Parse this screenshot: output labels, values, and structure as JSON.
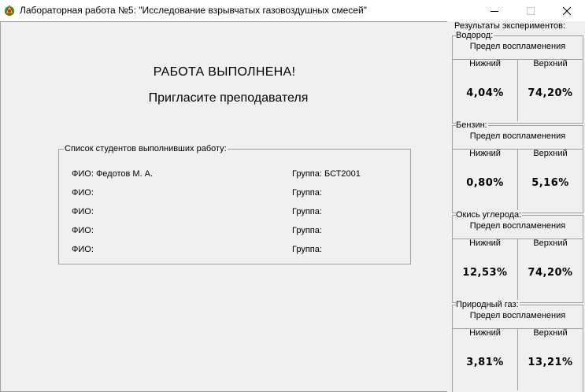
{
  "window": {
    "title": "Лабораторная работа №5: \"Исследование взрывчатых газовоздушных смесей\""
  },
  "main": {
    "done_title": "РАБОТА ВЫПОЛНЕНА!",
    "invite": "Пригласите преподавателя",
    "students_legend": "Список студентов выполнивших работу:",
    "students": [
      {
        "fio": "ФИО: Федотов М. А.",
        "group": "Группа: БСТ2001"
      },
      {
        "fio": "ФИО:",
        "group": "Группа:"
      },
      {
        "fio": "ФИО:",
        "group": "Группа:"
      },
      {
        "fio": "ФИО:",
        "group": "Группа:"
      },
      {
        "fio": "ФИО:",
        "group": "Группа:"
      }
    ]
  },
  "results": {
    "caption": "Результаты экспериментов:",
    "subtitle": "Предел воспламенения",
    "low_label": "Нижний",
    "high_label": "Верхний",
    "gases": [
      {
        "name": "Водород:",
        "low": "4,04%",
        "high": "74,20%"
      },
      {
        "name": "Бензин:",
        "low": "0,80%",
        "high": "5,16%"
      },
      {
        "name": "Окись углерода:",
        "low": "12,53%",
        "high": "74,20%"
      },
      {
        "name": "Природный газ:",
        "low": "3,81%",
        "high": "13,21%"
      }
    ]
  }
}
